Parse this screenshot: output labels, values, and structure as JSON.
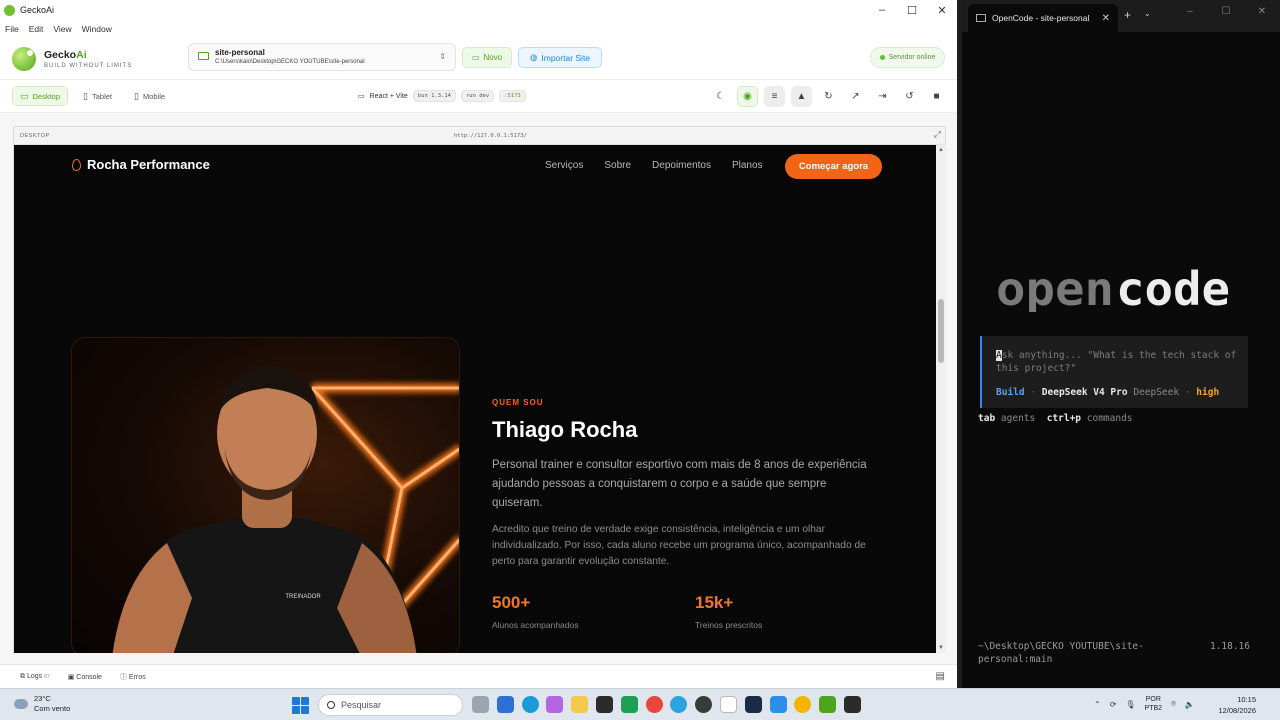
{
  "gecko": {
    "window_title": "GeckoAi",
    "menu": [
      "File",
      "Edit",
      "View",
      "Window"
    ],
    "brand": {
      "name_a": "Gecko",
      "name_b": "Ai",
      "tagline": "BUILD WITHOUT LIMITS"
    },
    "project": {
      "name": "site-personal",
      "path": "C:\\Users\\kaio\\Desktop\\GECKO YOUTUBE\\site-personal"
    },
    "novo_label": "Novo",
    "import_label": "Importar Site",
    "server_status": "Servidor online",
    "devices": [
      "Desktop",
      "Tablet",
      "Mobile"
    ],
    "stack_label": "React + Vite",
    "chips": [
      "bun 1.3.14",
      "run dev",
      ":5173"
    ],
    "preview_label": "DESKTOP",
    "preview_url": "http://127.0.0.1:5173/",
    "bottom": {
      "logs": "Logs",
      "logs_count": "87",
      "console": "Console",
      "errors": "Erros"
    }
  },
  "site": {
    "logo": "Rocha Performance",
    "nav": [
      "Serviços",
      "Sobre",
      "Depoimentos",
      "Planos"
    ],
    "cta": "Começar agora",
    "photo_shirt_text": "TREINADOR",
    "eyebrow": "QUEM SOU",
    "name": "Thiago Rocha",
    "lead": "Personal trainer e consultor esportivo com mais de 8 anos de experiência ajudando pessoas a conquistarem o corpo e a saúde que sempre quiseram.",
    "body": "Acredito que treino de verdade exige consistência, inteligência e um olhar individualizado. Por isso, cada aluno recebe um programa único, acompanhado de perto para garantir evolução constante.",
    "stats": [
      {
        "value": "500+",
        "label": "Alunos acompanhados"
      },
      {
        "value": "15k+",
        "label": "Treinos prescritos"
      }
    ]
  },
  "terminal": {
    "tab_title": "OpenCode - site-personal",
    "logo_a": "open",
    "logo_b": "code",
    "placeholder_first": "A",
    "placeholder_rest": "sk anything... \"What is the tech stack of this project?\"",
    "mode": {
      "agent": "Build",
      "model": "DeepSeek V4 Pro",
      "provider": "DeepSeek",
      "effort": "high"
    },
    "hints": {
      "k1": "tab",
      "t1": "agents",
      "k2": "ctrl+p",
      "t2": "commands"
    },
    "cwd": "~\\Desktop\\GECKO YOUTUBE\\site-personal:main",
    "version": "1.18.16"
  },
  "taskbar": {
    "temp": "23°C",
    "weather": "Com vento",
    "search_placeholder": "Pesquisar",
    "lang_a": "POR",
    "lang_b": "PTB2",
    "time": "10:15",
    "date": "12/08/2026"
  },
  "colors": {
    "accent_green": "#4ea51d",
    "site_orange": "#f26517",
    "opencode_blue": "#3b82f6"
  }
}
